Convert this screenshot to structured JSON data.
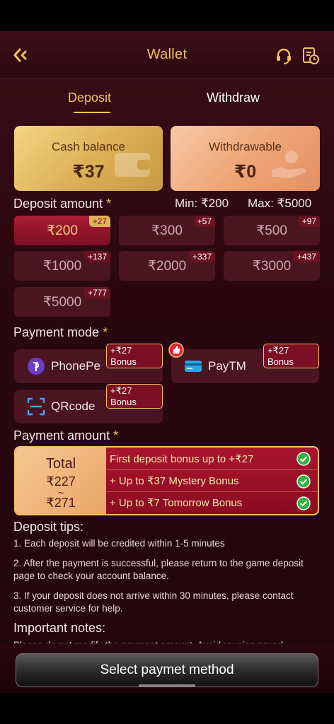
{
  "header": {
    "title": "Wallet"
  },
  "tabs": {
    "deposit": "Deposit",
    "withdraw": "Withdraw"
  },
  "balances": {
    "cash_label": "Cash balance",
    "cash_value": "₹37",
    "withdrawable_label": "Withdrawable",
    "withdrawable_value": "₹0"
  },
  "deposit_amount": {
    "label": "Deposit amount",
    "required": "*",
    "min": "Min: ₹200",
    "max": "Max: ₹5000",
    "options": [
      {
        "amount": "₹200",
        "bonus": "+27",
        "selected": true
      },
      {
        "amount": "₹300",
        "bonus": "+57"
      },
      {
        "amount": "₹500",
        "bonus": "+97"
      },
      {
        "amount": "₹1000",
        "bonus": "+137"
      },
      {
        "amount": "₹2000",
        "bonus": "+337"
      },
      {
        "amount": "₹3000",
        "bonus": "+437"
      },
      {
        "amount": "₹5000",
        "bonus": "+777"
      }
    ]
  },
  "payment_mode": {
    "label": "Payment mode",
    "required": "*",
    "options": [
      {
        "name": "PhonePe",
        "bonus": "+₹27 Bonus"
      },
      {
        "name": "PayTM",
        "bonus": "+₹27 Bonus"
      },
      {
        "name": "QRcode",
        "bonus": "+₹27 Bonus"
      }
    ]
  },
  "payment_amount": {
    "label": "Payment amount",
    "required": "*",
    "total_title": "Total",
    "total_from": "₹227",
    "separator": "~",
    "total_to": "₹271",
    "bonuses": [
      "First deposit bonus up to +₹27",
      "+ Up to ₹37 Mystery Bonus",
      "+ Up to ₹7 Tomorrow Bonus"
    ]
  },
  "tips": {
    "title": "Deposit tips:",
    "items": [
      "1. Each deposit will be credited within 1-5 minutes",
      "2. After the payment is successful, please return to the game deposit page to check your account balance.",
      "3. If your deposit does not arrive within 30 minutes, please contact customer service for help."
    ]
  },
  "notes": {
    "title": "Important notes:",
    "text": "Please do not modify the payment amount. Avoid reusing saved"
  },
  "action": {
    "select_label": "Select paymet method"
  },
  "colors": {
    "accent": "#f0c35a",
    "background": "#2a070f",
    "selected": "#a81c34",
    "tile": "#4a1521"
  }
}
